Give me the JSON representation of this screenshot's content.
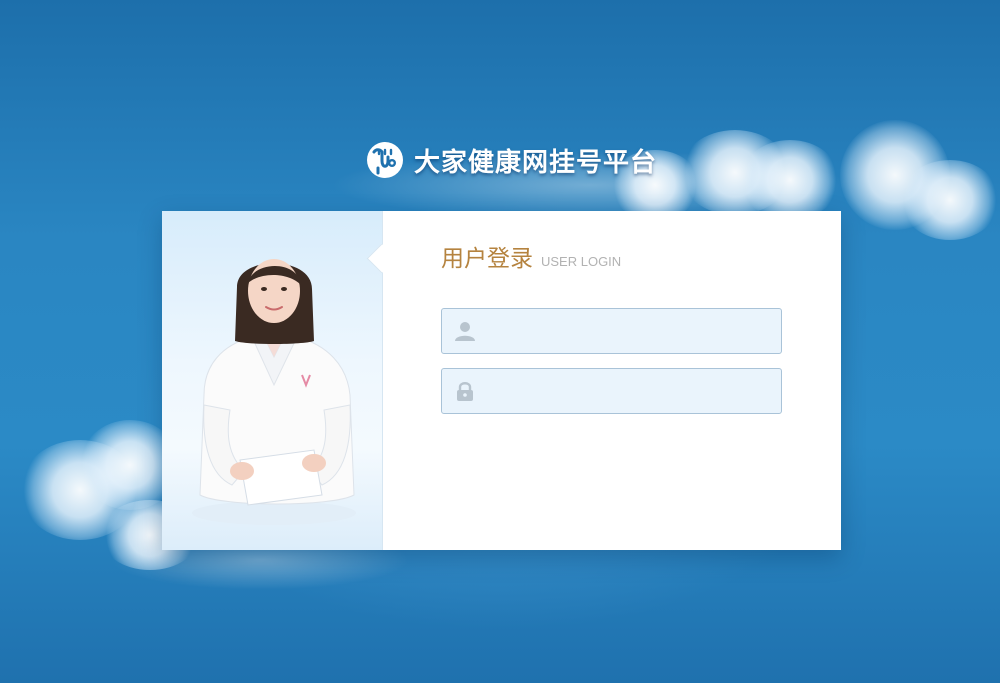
{
  "brand": {
    "title": "大家健康网挂号平台",
    "logo_icon": "stethoscope-logo-icon"
  },
  "login": {
    "title_cn": "用户登录",
    "title_en": "USER LOGIN",
    "username": {
      "icon": "user-icon",
      "value": "",
      "placeholder": ""
    },
    "password": {
      "icon": "lock-icon",
      "value": "",
      "placeholder": ""
    }
  },
  "photo": {
    "subject": "doctor-photo"
  },
  "colors": {
    "background": "#2b8ac6",
    "title_accent": "#b5833f",
    "subtitle": "#b2b2b2",
    "input_bg": "#eaf4fc",
    "input_border": "#a9c3d8",
    "icon_gray": "#b8c4ce"
  }
}
